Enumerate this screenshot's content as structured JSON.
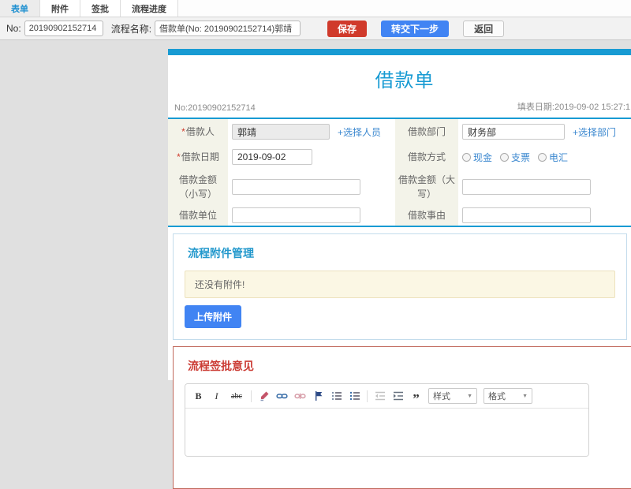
{
  "tabs": [
    {
      "label": "表单",
      "active": true
    },
    {
      "label": "附件",
      "active": false
    },
    {
      "label": "签批",
      "active": false
    },
    {
      "label": "流程进度",
      "active": false
    }
  ],
  "toolbar": {
    "no_label": "No:",
    "no_value": "20190902152714",
    "process_name_label": "流程名称:",
    "process_name_value": "借款单(No: 20190902152714)郭靖",
    "save_label": "保存",
    "next_label": "转交下一步",
    "back_label": "返回"
  },
  "form": {
    "title": "借款单",
    "doc_no": "No:20190902152714",
    "fill_date": "填表日期:2019-09-02 15:27:1",
    "required_mark": "*",
    "borrower": {
      "label": "借款人",
      "value": "郭靖",
      "action": "+选择人员"
    },
    "department": {
      "label": "借款部门",
      "value": "财务部",
      "action": "+选择部门"
    },
    "loan_date": {
      "label": "借款日期",
      "value": "2019-09-02"
    },
    "method": {
      "label": "借款方式",
      "options": [
        "现金",
        "支票",
        "电汇"
      ]
    },
    "amount_lower": {
      "label": "借款金额（小写）"
    },
    "amount_upper": {
      "label": "借款金额（大写）"
    },
    "unit": {
      "label": "借款单位"
    },
    "reason": {
      "label": "借款事由"
    }
  },
  "attachments": {
    "heading": "流程附件管理",
    "empty_text": "还没有附件!",
    "upload_label": "上传附件"
  },
  "approval": {
    "heading": "流程签批意见",
    "editor": {
      "bold": "B",
      "italic": "I",
      "strike": "abc",
      "quote": "”",
      "styles_label": "样式",
      "format_label": "格式"
    }
  },
  "colors": {
    "accent_blue": "#189bd3",
    "link_blue": "#3a87cf",
    "save_red": "#d03a2b",
    "primary_blue": "#4184f3",
    "heading_red": "#cb3b34",
    "label_bg": "#f3f3e9"
  }
}
